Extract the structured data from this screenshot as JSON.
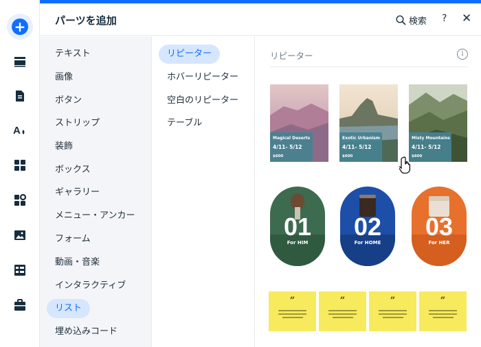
{
  "header": {
    "title": "パーツを追加",
    "search_label": "検索",
    "help_label": "?",
    "close_label": "✕"
  },
  "rail": {
    "add_symbol": "+"
  },
  "categories": [
    {
      "label": "テキスト",
      "active": false
    },
    {
      "label": "画像",
      "active": false
    },
    {
      "label": "ボタン",
      "active": false
    },
    {
      "label": "ストリップ",
      "active": false
    },
    {
      "label": "装飾",
      "active": false
    },
    {
      "label": "ボックス",
      "active": false
    },
    {
      "label": "ギャラリー",
      "active": false
    },
    {
      "label": "メニュー・アンカー",
      "active": false
    },
    {
      "label": "フォーム",
      "active": false
    },
    {
      "label": "動画・音楽",
      "active": false
    },
    {
      "label": "インタラクティブ",
      "active": false
    },
    {
      "label": "リスト",
      "active": true
    },
    {
      "label": "埋め込みコード",
      "active": false
    }
  ],
  "subcategories": [
    {
      "label": "リピーター",
      "active": true
    },
    {
      "label": "ホバーリピーター",
      "active": false
    },
    {
      "label": "空白のリピーター",
      "active": false
    },
    {
      "label": "テーブル",
      "active": false
    }
  ],
  "section": {
    "title": "リピーター",
    "info_symbol": "i"
  },
  "travel_cards": [
    {
      "name": "Magical Deserts",
      "dates": "4/11- 5/12",
      "price": "$600"
    },
    {
      "name": "Exotic Urbanism",
      "dates": "4/11- 5/12",
      "price": "$600"
    },
    {
      "name": "Misty Mountains",
      "dates": "4/11- 5/12",
      "price": "$600"
    }
  ],
  "product_cards": [
    {
      "number": "01",
      "label": "For HIM",
      "color": "#3d6b4f"
    },
    {
      "number": "02",
      "label": "For HOME",
      "color": "#1d4fa8"
    },
    {
      "number": "03",
      "label": "For HER",
      "color": "#e8702d"
    }
  ],
  "quote_cards": [
    {
      "mark": "”"
    },
    {
      "mark": "”"
    },
    {
      "mark": "”"
    },
    {
      "mark": "”"
    }
  ],
  "colors": {
    "accent": "#116dff",
    "active_bg": "#d6e6fe",
    "note": "#f7ea5d"
  }
}
